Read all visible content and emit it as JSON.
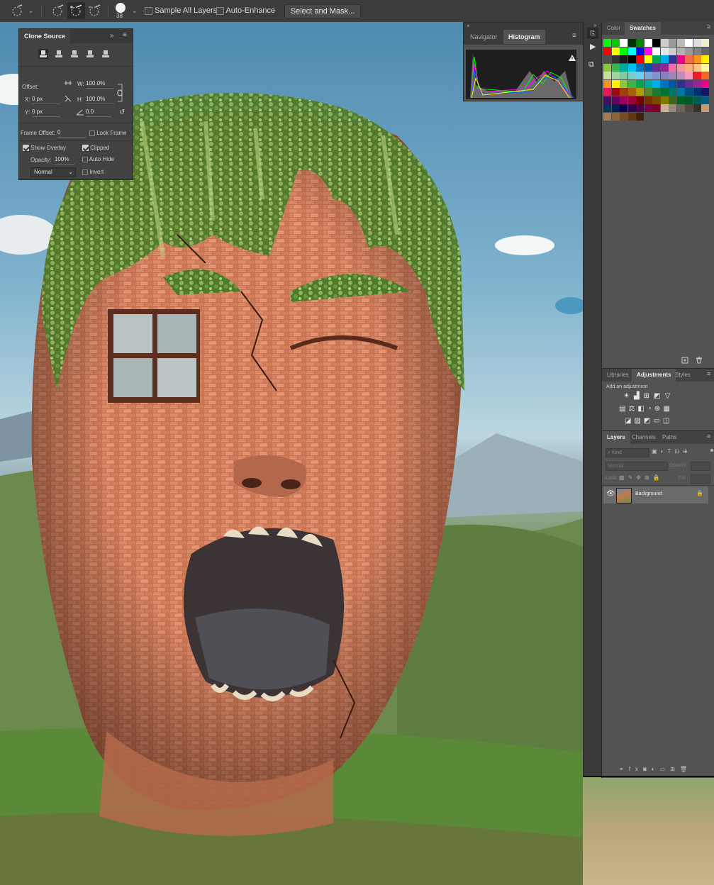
{
  "options_bar": {
    "brush_size": "38",
    "sample_all_layers_label": "Sample All Layers",
    "sample_all_layers_checked": false,
    "auto_enhance_label": "Auto-Enhance",
    "auto_enhance_checked": false,
    "select_mask_label": "Select and Mask..."
  },
  "clone_source": {
    "title": "Clone Source",
    "offset_label": "Offset:",
    "w_label": "W:",
    "w_value": "100.0%",
    "h_label": "H:",
    "h_value": "100.0%",
    "x_label": "X:",
    "x_value": "0 px",
    "y_label": "Y:",
    "y_value": "0 px",
    "angle_value": "0.0",
    "frame_offset_label": "Frame Offset:",
    "frame_offset_value": "0",
    "lock_frame_label": "Lock Frame",
    "lock_frame_checked": false,
    "show_overlay_label": "Show Overlay",
    "show_overlay_checked": true,
    "clipped_label": "Clipped",
    "clipped_checked": true,
    "opacity_label": "Opacity:",
    "opacity_value": "100%",
    "auto_hide_label": "Auto Hide",
    "auto_hide_checked": false,
    "blend_mode": "Normal",
    "invert_label": "Invert",
    "invert_checked": false
  },
  "histogram_panel": {
    "tabs": [
      "Navigator",
      "Histogram"
    ],
    "active_tab": "Histogram"
  },
  "swatches_panel": {
    "tabs": [
      "Color",
      "Swatches"
    ],
    "active_tab": "Swatches",
    "colors": [
      "#00ff00",
      "#00cc00",
      "#ffffff",
      "#003300",
      "#008800",
      "#ffffff",
      "#000000",
      "#cccccc",
      "#999999",
      "#bbbbbb",
      "#ffffff",
      "#dddddd",
      "#eeeecc",
      "#ff0000",
      "#ffff00",
      "#00ff00",
      "#00ffff",
      "#0000ff",
      "#ff00ff",
      "#ffffff",
      "#e6e6e6",
      "#cccccc",
      "#b3b3b3",
      "#999999",
      "#808080",
      "#666666",
      "#4d4d4d",
      "#333333",
      "#1a1a1a",
      "#000000",
      "#ff0000",
      "#ffff00",
      "#00a651",
      "#00aeef",
      "#2e3192",
      "#ec008c",
      "#f26c4f",
      "#f7941d",
      "#fff200",
      "#8dc63f",
      "#39b54a",
      "#00a99d",
      "#00bff3",
      "#0072bc",
      "#0054a6",
      "#662d91",
      "#92278f",
      "#f06eaa",
      "#f5989d",
      "#f9ad81",
      "#fdc689",
      "#fff799",
      "#c4df9b",
      "#a3d39c",
      "#82ca9c",
      "#7accc8",
      "#6dcff6",
      "#7da7d9",
      "#8393ca",
      "#8781bd",
      "#a186be",
      "#bd8cbf",
      "#f49ac1",
      "#ed1c24",
      "#f26522",
      "#f7941d",
      "#fff200",
      "#8dc63f",
      "#39b54a",
      "#00a651",
      "#00a99d",
      "#00aeef",
      "#0072bc",
      "#0054a6",
      "#2e3192",
      "#662d91",
      "#92278f",
      "#ec008c",
      "#ed145b",
      "#9e0b0f",
      "#a0410d",
      "#a36209",
      "#aba000",
      "#598527",
      "#1a7b30",
      "#007236",
      "#00746b",
      "#0076a3",
      "#004a80",
      "#003471",
      "#1b1464",
      "#440e62",
      "#630460",
      "#9e005d",
      "#9e0039",
      "#790000",
      "#7b2e00",
      "#7d4900",
      "#827b00",
      "#406618",
      "#005e20",
      "#005826",
      "#005952",
      "#005b7f",
      "#003663",
      "#002157",
      "#0d004c",
      "#32004b",
      "#4b0049",
      "#7b0046",
      "#7a0026",
      "#c7b299",
      "#998675",
      "#736357",
      "#534741",
      "#37302d",
      "#c69c6d",
      "#a67c52",
      "#8c6239",
      "#754c24",
      "#603913",
      "#42210b"
    ]
  },
  "adjustments_panel": {
    "tabs": [
      "Libraries",
      "Adjustments",
      "Styles"
    ],
    "active_tab": "Adjustments",
    "add_label": "Add an adjustment"
  },
  "layers_panel": {
    "tabs": [
      "Layers",
      "Channels",
      "Paths"
    ],
    "active_tab": "Layers",
    "kind_placeholder": "Kind",
    "blend_mode": "Normal",
    "opacity_label": "Opacity:",
    "lock_label": "Lock:",
    "fill_label": "Fill:",
    "layers": [
      {
        "name": "Background",
        "visible": true,
        "locked": true
      }
    ]
  }
}
